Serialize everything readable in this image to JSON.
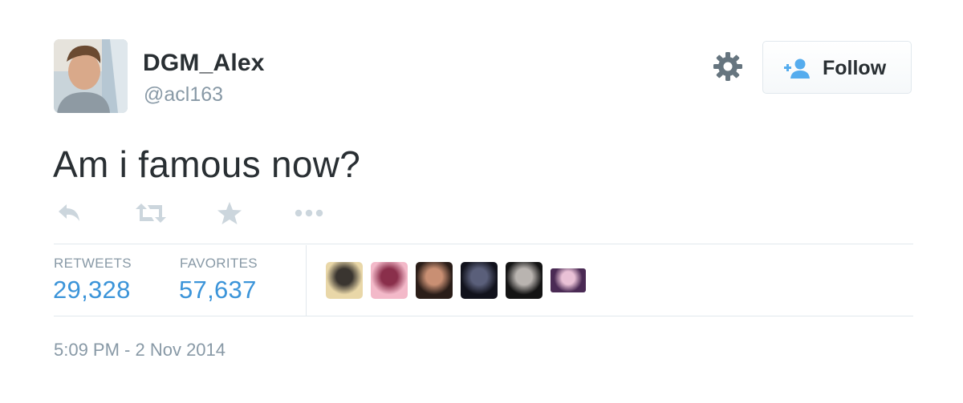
{
  "tweet": {
    "display_name": "DGM_Alex",
    "handle": "@acl163",
    "text": "Am i famous now?",
    "timestamp": "5:09 PM - 2 Nov 2014"
  },
  "header": {
    "follow_label": "Follow",
    "gear_icon": "gear-icon",
    "follow_icon": "add-user-icon"
  },
  "actions": [
    {
      "icon": "reply-icon"
    },
    {
      "icon": "retweet-icon"
    },
    {
      "icon": "favorite-star-icon"
    },
    {
      "icon": "more-dots-icon"
    }
  ],
  "stats": {
    "retweets_label": "RETWEETS",
    "retweets_value": "29,328",
    "favorites_label": "FAVORITES",
    "favorites_value": "57,637"
  },
  "favoriter_avatars": [
    {
      "colors": [
        "#e9d7a8",
        "#3a3530"
      ]
    },
    {
      "colors": [
        "#f3b9c9",
        "#8a2f4b"
      ]
    },
    {
      "colors": [
        "#2a1d18",
        "#c98f73"
      ]
    },
    {
      "colors": [
        "#11121c",
        "#5a5f7a"
      ]
    },
    {
      "colors": [
        "#141414",
        "#b9b4b0"
      ]
    },
    {
      "colors": [
        "#4a2a54",
        "#e9c1d6"
      ]
    }
  ],
  "colors": {
    "text": "#292f33",
    "muted": "#8899a6",
    "link": "#3b94d9",
    "follow_icon": "#55acee",
    "action_icon": "#ccd6dd",
    "divider": "#e1e8ed"
  }
}
